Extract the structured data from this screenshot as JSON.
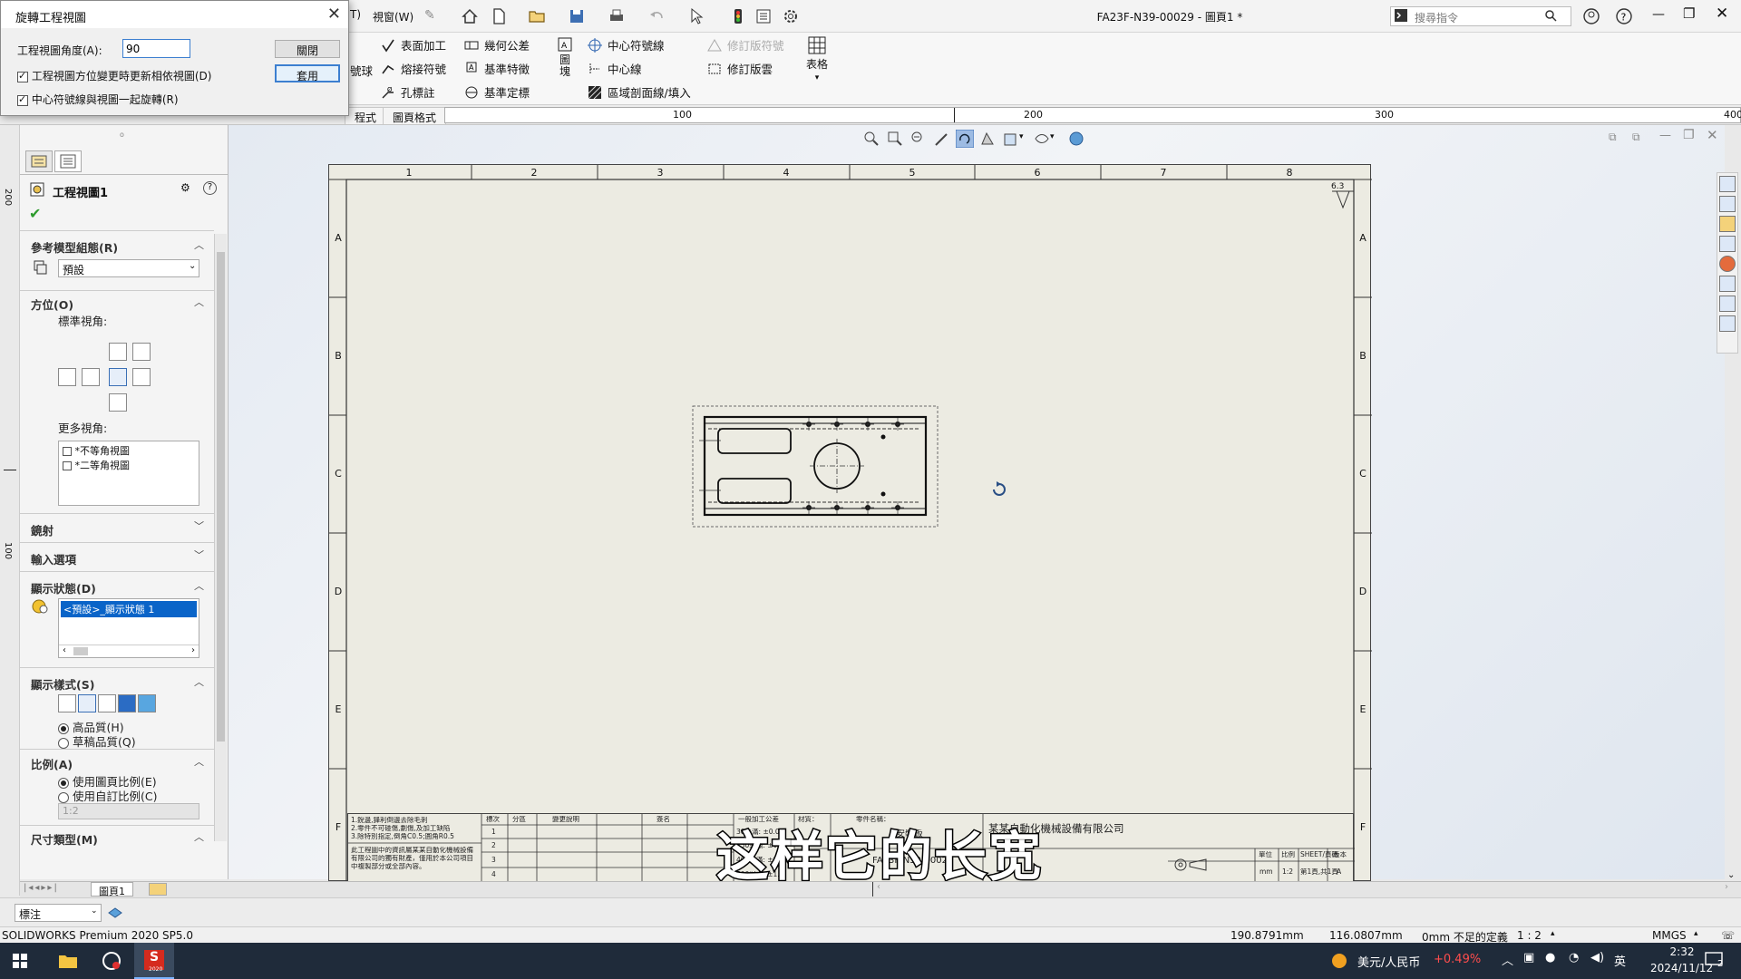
{
  "app": {
    "document_title": "FA23F-N39-00029 - 圖頁1 *",
    "menu_window": "視窗(W)",
    "menu_cut": "T)",
    "search_placeholder": "搜尋指令"
  },
  "ribbon": {
    "items": [
      "表面加工",
      "熔接符號",
      "孔標註",
      "幾何公差",
      "基準特徵",
      "基準定標",
      "中心符號線",
      "中心線",
      "區域剖面線/填入",
      "修訂版符號",
      "修訂版雲",
      "表格"
    ],
    "block_label": "圖塊",
    "left_cut_1": "號球"
  },
  "tabs": [
    "程式",
    "圖頁格式"
  ],
  "ruler": {
    "ticks": [
      "100",
      "200",
      "300",
      "400"
    ]
  },
  "dialog": {
    "title": "旋轉工程視圖",
    "angle_label": "工程視圖角度(A):",
    "angle_value": "90",
    "close_button": "關閉",
    "apply_button": "套用",
    "option_1": "工程視圖方位變更時更新相依視圖(D)",
    "option_2": "中心符號線與視圖一起旋轉(R)"
  },
  "panel": {
    "title": "工程視圖1",
    "sec_ref": "參考模型組態(R)",
    "config_value": "預設",
    "sec_orient": "方位(O)",
    "std_views": "標準視角:",
    "more_views": "更多視角:",
    "more_list": [
      "*不等角視圖",
      "*二等角視圖"
    ],
    "sec_mirror": "鏡射",
    "sec_import": "輸入選項",
    "sec_display_state": "顯示狀態(D)",
    "display_state_value": "<預設>_顯示狀態 1",
    "sec_display_style": "顯示樣式(S)",
    "hq": "高品質(H)",
    "draft": "草稿品質(Q)",
    "sec_scale": "比例(A)",
    "use_sheet_scale": "使用圖頁比例(E)",
    "use_custom_scale": "使用自訂比例(C)",
    "scale_value": "1:2",
    "sec_dim_type": "尺寸類型(M)"
  },
  "left_ruler": {
    "labels": [
      "200",
      "100"
    ]
  },
  "sheet": {
    "cols": [
      "1",
      "2",
      "3",
      "4",
      "5",
      "6",
      "7",
      "8"
    ],
    "rows": [
      "A",
      "B",
      "C",
      "D",
      "E",
      "F"
    ],
    "roughness": "6.3"
  },
  "title_block": {
    "notes": [
      "1.銳邊,鋒利倒邊去除毛刺",
      "2.零件不可碰傷,劃傷,及加工缺陷",
      "3.除特別指定,倒角C0.5;圓角R0.5"
    ],
    "copyright": [
      "此工程圖中的資訊屬某某自動化機械設備",
      "有限公司的獨有財產，僅用於本公司項目",
      "中複製部分或全部內容。"
    ],
    "headers": [
      "標次",
      "分區",
      "變更說明",
      "簽名"
    ],
    "rev_rows": [
      "1",
      "2",
      "3",
      "4"
    ],
    "tolerances": [
      "30未滿: ±0.05",
      "150未滿: ±0.2",
      "400未滿: ±0.3",
      "500以上: ±1.0"
    ],
    "tol_title": "一般加工公差",
    "material_label": "材質：",
    "part_label": "零件名稱：",
    "part_name": "安裝板",
    "company": "某某自動化機械設備有限公司",
    "drawing_no": "FA23F-N39-00029",
    "small_headers": [
      "單位",
      "比例",
      "SHEET/頁碼",
      "版本"
    ],
    "small_values": [
      "mm",
      "1:2",
      "第1頁,共1頁",
      "A"
    ]
  },
  "subtitle": "这样它的长宽",
  "sheet_tab": "圖頁1",
  "annotation_combo": "標注",
  "status": {
    "product": "SOLIDWORKS Premium 2020 SP5.0",
    "x": "190.8791mm",
    "y": "116.0807mm",
    "z": "0mm 不足的定義",
    "scale": "1 : 2",
    "units": "MMGS"
  },
  "taskbar": {
    "currency": "美元/人民币",
    "change": "+0.49%",
    "ime": "英",
    "time": "2:32",
    "date": "2024/11/12",
    "notif_count": "2",
    "sw_badge": "2020"
  },
  "colors": {
    "accent": "#3c7fd0",
    "selection": "#0a64c8",
    "taskbar": "#1f2b3a",
    "change_red": "#ff4d4d"
  }
}
